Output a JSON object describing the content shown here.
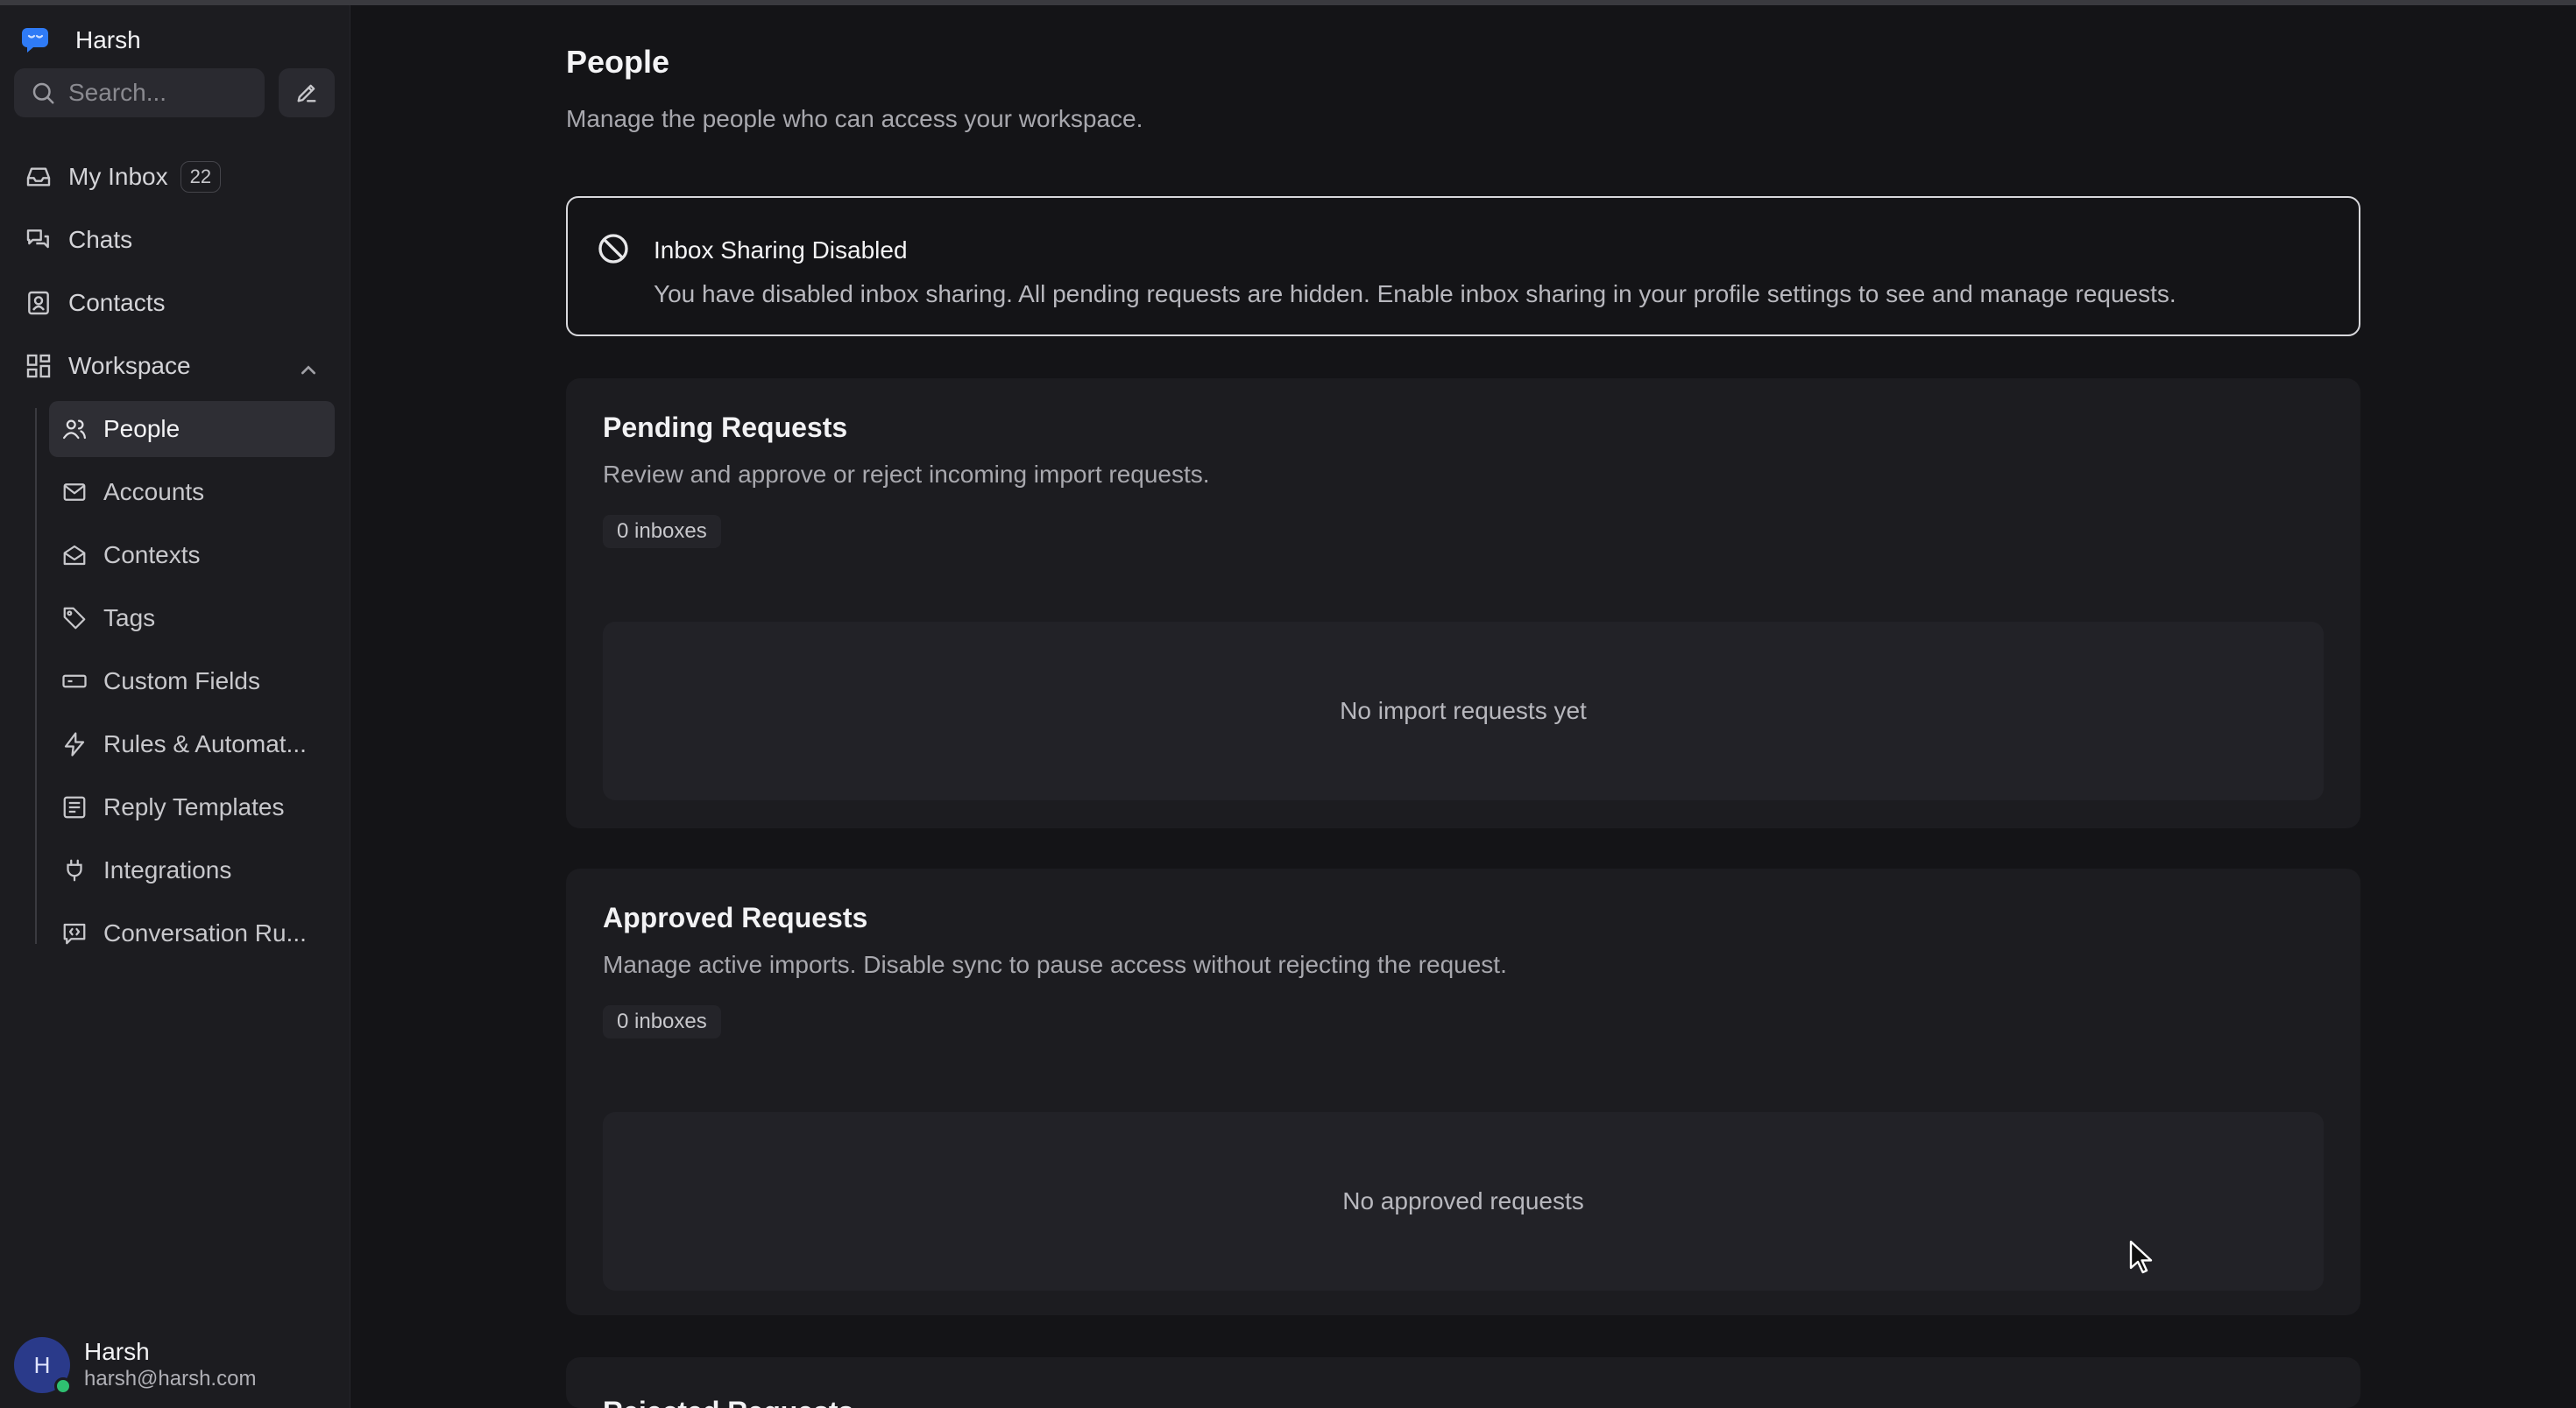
{
  "app": {
    "name": "Harsh"
  },
  "sidebar": {
    "search_placeholder": "Search...",
    "nav": [
      {
        "label": "My Inbox",
        "badge": "22",
        "icon": "inbox-icon"
      },
      {
        "label": "Chats",
        "icon": "chat-icon"
      },
      {
        "label": "Contacts",
        "icon": "contacts-icon"
      },
      {
        "label": "Workspace",
        "icon": "grid-icon",
        "expanded": true
      }
    ],
    "workspace_items": [
      {
        "label": "People",
        "icon": "users-icon",
        "active": true
      },
      {
        "label": "Accounts",
        "icon": "mail-icon"
      },
      {
        "label": "Contexts",
        "icon": "open-mail-icon"
      },
      {
        "label": "Tags",
        "icon": "tag-icon"
      },
      {
        "label": "Custom Fields",
        "icon": "field-icon"
      },
      {
        "label": "Rules & Automat...",
        "icon": "bolt-icon"
      },
      {
        "label": "Reply Templates",
        "icon": "template-icon"
      },
      {
        "label": "Integrations",
        "icon": "plug-icon"
      },
      {
        "label": "Conversation Ru...",
        "icon": "code-chat-icon"
      }
    ],
    "user": {
      "initial": "H",
      "name": "Harsh",
      "email": "harsh@harsh.com"
    }
  },
  "main": {
    "title": "People",
    "subtitle": "Manage the people who can access your workspace.",
    "alert": {
      "title": "Inbox Sharing Disabled",
      "body": "You have disabled inbox sharing. All pending requests are hidden. Enable inbox sharing in your profile settings to see and manage requests."
    },
    "pending": {
      "title": "Pending Requests",
      "subtitle": "Review and approve or reject incoming import requests.",
      "count": "0 inboxes",
      "empty": "No import requests yet"
    },
    "approved": {
      "title": "Approved Requests",
      "subtitle": "Manage active imports. Disable sync to pause access without rejecting the request.",
      "count": "0 inboxes",
      "empty": "No approved requests"
    },
    "rejected": {
      "title": "Rejected Requests"
    }
  },
  "colors": {
    "accent": "#2f7bf6",
    "online": "#2fbf71",
    "avatar_bg": "#2a3a8a"
  }
}
